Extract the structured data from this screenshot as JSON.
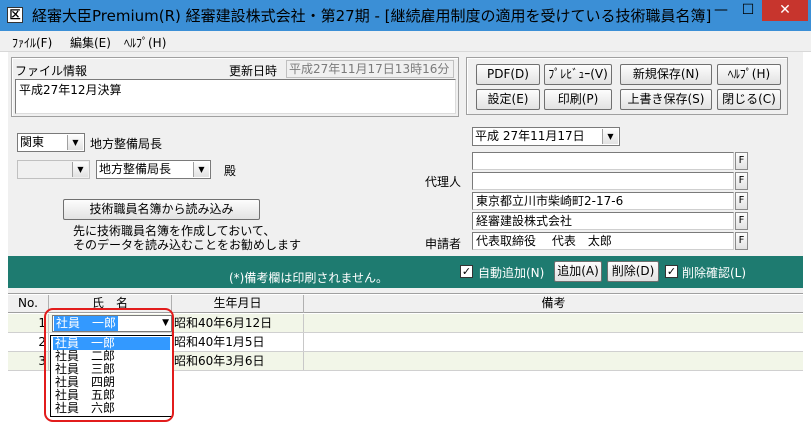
{
  "window": {
    "icon_glyph": "区",
    "title": "経審大臣Premium(R)  経審建設株式会社・第27期 - [継続雇用制度の適用を受けている技術職員名簿]",
    "minimize_glyph": "—",
    "maximize_glyph": "☐",
    "close_glyph": "✕"
  },
  "menu": {
    "file": "ﾌｧｲﾙ(F)",
    "edit": "編集(E)",
    "help": "ﾍﾙﾌﾟ(H)"
  },
  "file_info": {
    "label": "ファイル情報",
    "updated_label": "更新日時",
    "updated_value": "平成27年11月17日13時16分",
    "memo": "平成27年12月決算"
  },
  "buttons": {
    "pdf": "PDF(D)",
    "preview": "ﾌﾟﾚﾋﾞｭｰ(V)",
    "save_new": "新規保存(N)",
    "help": "ﾍﾙﾌﾟ(H)",
    "settings": "設定(E)",
    "print": "印刷(P)",
    "overwrite": "上書き保存(S)",
    "close": "閉じる(C)",
    "import_staff": "技術職員名簿から読み込み",
    "add": "追加(A)",
    "delete": "削除(D)"
  },
  "addressee": {
    "region_value": "関東",
    "region_suffix": "地方整備局長",
    "office_value": "",
    "title_value": "地方整備局長",
    "honorific": "殿"
  },
  "import_hint": {
    "line1": "先に技術職員名簿を作成しておいて、",
    "line2": "そのデータを読み込むことをお勧めします"
  },
  "applicant": {
    "date_value": "平成 27年11月17日",
    "agent_label": "代理人",
    "agent_line1": "",
    "agent_line2": "",
    "address": "東京都立川市柴崎町2-17-6",
    "company": "経審建設株式会社",
    "applicant_label": "申請者",
    "representative": "代表取締役　 代表　太郎",
    "f_label": "F"
  },
  "notice": {
    "text": "(*)備考欄は印刷されません。",
    "auto_add": "自動追加(N)",
    "confirm_delete": "削除確認(L)",
    "check_glyph": "✓"
  },
  "grid": {
    "columns": [
      "No.",
      "氏　名",
      "生年月日",
      "備考"
    ],
    "rows": [
      {
        "no": "1",
        "name": "社員　一郎",
        "dob": "昭和40年6月12日",
        "note": ""
      },
      {
        "no": "2",
        "name": "",
        "dob": "昭和40年1月5日",
        "note": ""
      },
      {
        "no": "3",
        "name": "",
        "dob": "昭和60年3月6日",
        "note": ""
      }
    ],
    "dropdown_arrow": "▼"
  },
  "name_dropdown": {
    "options": [
      "社員　一郎",
      "社員　二郎",
      "社員　三郎",
      "社員　四朗",
      "社員　五郎",
      "社員　六郎"
    ],
    "selected_index": 0
  },
  "colors": {
    "titlebar": "#3b8fd6",
    "notice_band": "#1e7b70",
    "selection": "#3399ff",
    "highlight": "#e21c1c"
  }
}
